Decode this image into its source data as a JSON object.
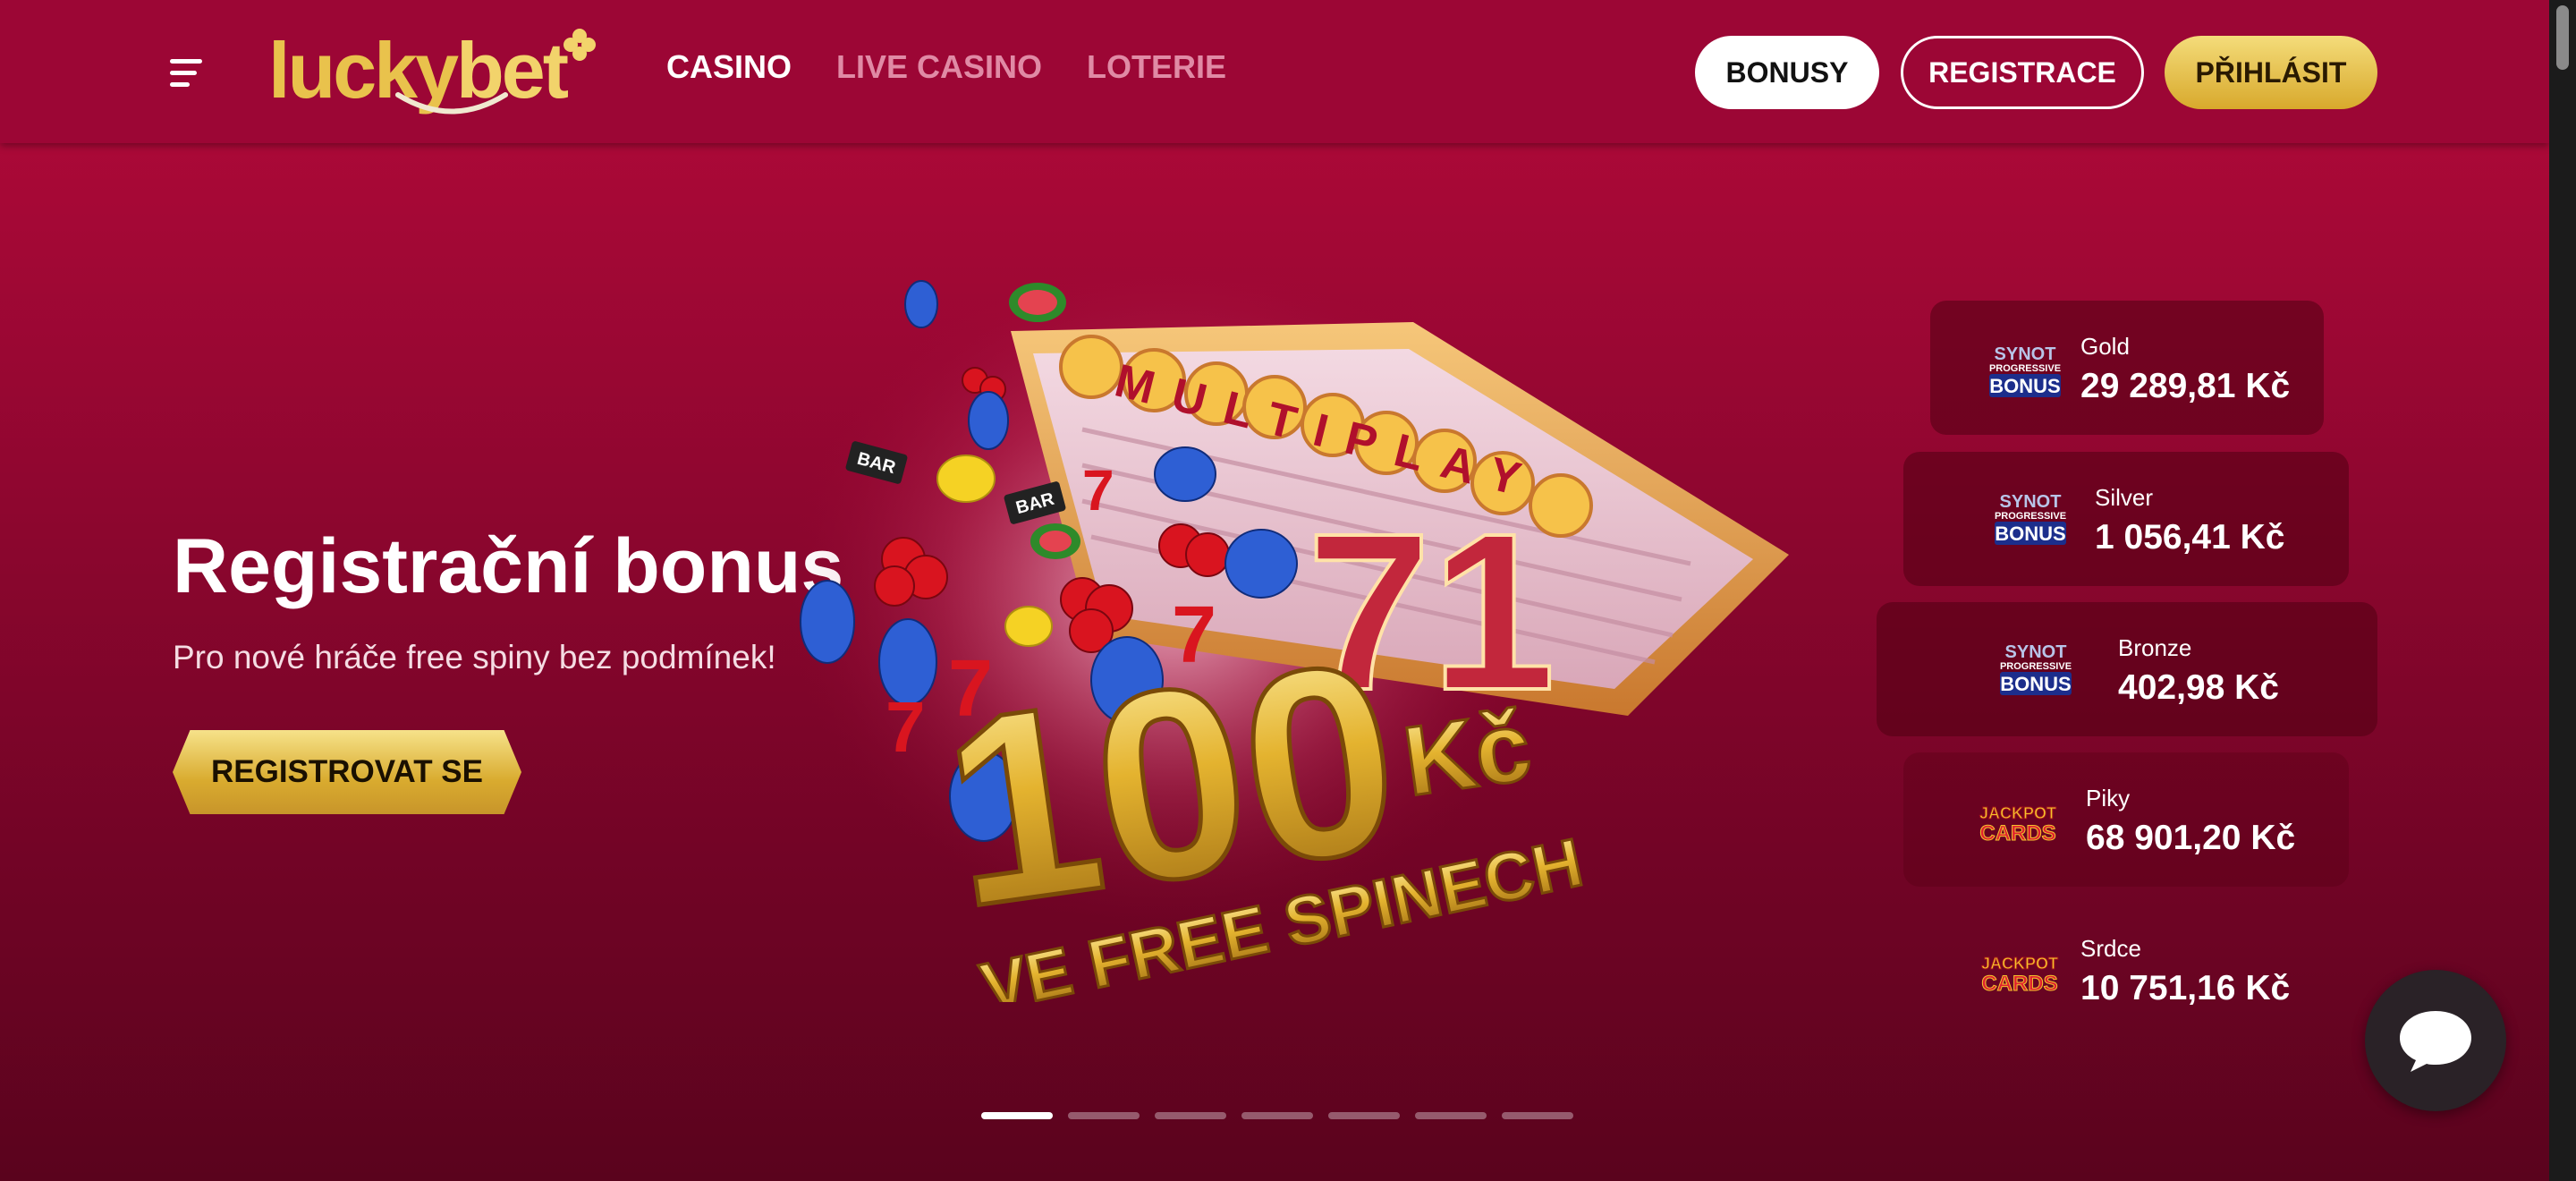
{
  "header": {
    "logo_alt": "luckybet",
    "logo_part1": "lucky",
    "logo_part2": "bet",
    "nav": [
      {
        "label": "CASINO",
        "active": true
      },
      {
        "label": "LIVE CASINO",
        "active": false
      },
      {
        "label": "LOTERIE",
        "active": false
      }
    ],
    "buttons": {
      "bonusy": "BONUSY",
      "registrace": "REGISTRACE",
      "prihlasit": "PŘIHLÁSIT"
    }
  },
  "hero": {
    "title": "Registrační bonus",
    "subtitle": "Pro nové hráče free spiny bez podmínek!",
    "cta": "REGISTROVAT SE",
    "banner": {
      "sign": "MULTIPLAY",
      "amount": "100",
      "currency": "Kč",
      "caption": "VE FREE SPINECH"
    }
  },
  "jackpots": [
    {
      "provider": "SYNOT PROGRESSIVE BONUS",
      "name": "Gold",
      "amount": "29 289,81 Kč"
    },
    {
      "provider": "SYNOT PROGRESSIVE BONUS",
      "name": "Silver",
      "amount": "1 056,41 Kč"
    },
    {
      "provider": "SYNOT PROGRESSIVE BONUS",
      "name": "Bronze",
      "amount": "402,98 Kč"
    },
    {
      "provider": "JACKPOT CARDS",
      "name": "Piky",
      "amount": "68 901,20 Kč"
    },
    {
      "provider": "JACKPOT CARDS",
      "name": "Srdce",
      "amount": "10 751,16 Kč"
    }
  ],
  "slider": {
    "count": 7,
    "active_index": 0
  },
  "colors": {
    "brand_red": "#9c0635",
    "gold": "#e9c24c",
    "white": "#ffffff"
  },
  "icons": {
    "menu": "hamburger-menu-icon",
    "chat": "chat-bubble-icon"
  }
}
